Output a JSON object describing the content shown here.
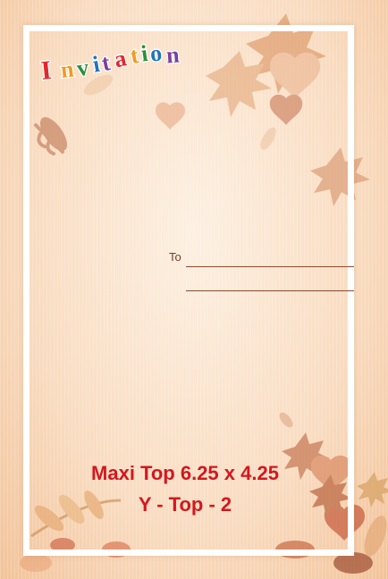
{
  "card": {
    "title": "Invitation",
    "to_label": "To",
    "size_line": "Maxi Top 6.25 x 4.25",
    "code_line": "Y - Top - 2"
  },
  "colors": {
    "background": "#f9dcc1",
    "frame": "#ffffff",
    "size_text": "#d4171f",
    "to_text": "#7a3b20",
    "title_letters": [
      "#e3262d",
      "#f39a1f",
      "#2b8f3a",
      "#1e73be",
      "#7b3fa0",
      "#e3262d",
      "#f39a1f",
      "#2b8f3a",
      "#1e73be",
      "#7b3fa0"
    ]
  },
  "icons": [
    "maple-leaf-icon",
    "heart-leaf-icon",
    "wheat-icon"
  ]
}
